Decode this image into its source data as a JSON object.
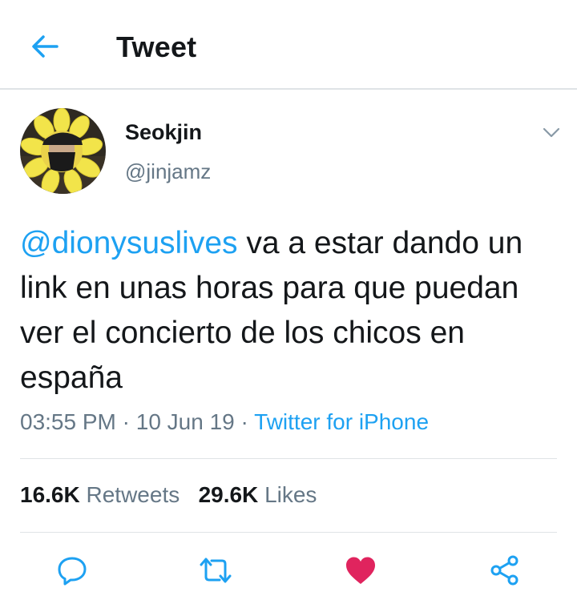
{
  "header": {
    "back_icon": "arrow-left-icon",
    "title": "Tweet"
  },
  "tweet": {
    "author": {
      "display_name": "Seokjin",
      "handle": "@jinjamz",
      "avatar_icon": "avatar-sunflower-costume"
    },
    "menu_icon": "chevron-down-icon",
    "mention": "@dionysuslives",
    "text": " va a estar dando un link en unas horas para que puedan ver el concierto de los chicos en españa",
    "time": "03:55 PM",
    "separator": "·",
    "date": "10 Jun 19",
    "source": "Twitter for iPhone",
    "retweets_count": "16.6K",
    "retweets_label": "Retweets",
    "likes_count": "29.6K",
    "likes_label": "Likes"
  },
  "actions": {
    "reply_icon": "reply-icon",
    "retweet_icon": "retweet-icon",
    "like_icon": "heart-icon",
    "share_icon": "share-icon"
  },
  "colors": {
    "accent": "#1da1f2",
    "like": "#e0245e",
    "secondary_text": "#657786",
    "primary_text": "#14171a",
    "divider": "#dfe3e6"
  }
}
